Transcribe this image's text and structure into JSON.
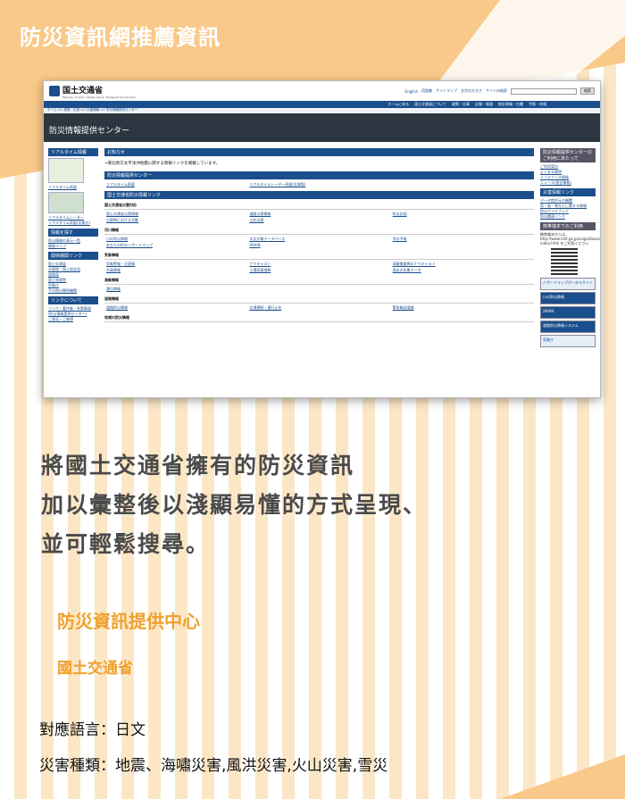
{
  "header": {
    "title": "防災資訊網推薦資訊"
  },
  "screenshot": {
    "logo_name": "国土交通省",
    "logo_en": "Ministry of Land, Infrastructure, Transport and Tourism",
    "util_links": [
      "English",
      "用語集",
      "サイトマップ",
      "文字の大きさ",
      "サイト内検索"
    ],
    "search_button": "検索",
    "nav_items": [
      "ホームに戻る",
      "国土交通省について",
      "政策・仕事",
      "広報・報道",
      "統計情報・白書",
      "手続・申請"
    ],
    "breadcrumb": "ホーム >> 政策・仕事 >> 災害情報 >> 防災情報提供センター",
    "banner_title": "防災情報提供センター",
    "left": {
      "realtime_header": "リアルタイム情報",
      "realtime_links": [
        "リアルタイム雨量",
        "リアルタイムレーダー",
        "リアルタイム雨量(気象庁)"
      ],
      "info_header": "情報を探す",
      "info_links": [
        "防災情報の表示一覧",
        "情報マップ"
      ],
      "related_header": "関係機関リンク",
      "related_links": [
        "国土交通省",
        "水管理・国土保全局",
        "道路局",
        "国土地理院",
        "気象庁",
        "その他の関係機関"
      ],
      "about_header": "リンクについて",
      "about_links": [
        "リンク・著作権・免責事項",
        "(防災情報提供センター)",
        "ご意見・ご感想"
      ]
    },
    "main": {
      "notice_header": "お知らせ",
      "notice_text": "→東北地方太平洋沖地震に関する情報リンクを掲載しています。",
      "center_header": "防災情報提供センター",
      "center_links": [
        "リアルタイム雨量",
        "リアルタイムレーダー雨量(広域版)"
      ],
      "mlit_header": "国土交通省防災情報リンク",
      "sections": [
        {
          "title": "国土交通省災害対応",
          "links": [
            "国土交通省災害情報",
            "道路災害情報",
            "防災計画",
            "災害時における活動",
            "土砂災害"
          ]
        },
        {
          "title": "河川情報",
          "links": [
            "川の防災情報",
            "水文水質データベース",
            "洪水予報",
            "あなたの町のハザードマップ",
            "XRAIN",
            ""
          ]
        },
        {
          "title": "気象情報",
          "links": [
            "気象警報・注意報",
            "ナウキャスト",
            "高解像度降水ナウキャスト",
            "台風情報",
            "土壌雨量指数",
            "過去の気象データ"
          ]
        },
        {
          "title": "海象情報",
          "links": [
            "潮位情報",
            "",
            ""
          ]
        },
        {
          "title": "道路情報",
          "links": [
            "道路防災情報",
            "交通規制・通行止め",
            "緊急輸送道路"
          ]
        },
        {
          "title": "地域の防災情報",
          "links": []
        }
      ]
    },
    "right": {
      "use_header": "防災情報提供センターのご利用にあたって",
      "use_links": [
        "ご利用案内",
        "よくある質問",
        "メンテナンス情報",
        "ニュース(過去情報)"
      ],
      "disaster_header": "災害情報リンク",
      "disaster_links": [
        "データ提供元の機関",
        "雨・風・雪などに関する情報",
        "防災ガイドブック",
        "防災関連リンク"
      ],
      "mobile_header": "携帯端末でのご利用",
      "mobile_text": "携帯端末からは、http://www.mlit.go.jp/saigai/bosaijoho/i-index.html をご利用ください",
      "banners": [
        "ハザードマップポータルサイト",
        "川の防災情報",
        "XRAIN",
        "道路防災情報システム",
        "気象庁"
      ]
    }
  },
  "description": [
    "將國土交通省擁有的防災資訊",
    "加以彙整後以淺顯易懂的方式呈現、",
    "並可輕鬆搜尋。"
  ],
  "organization": {
    "name": "防災資訊提供中心",
    "ministry": "國土交通省"
  },
  "meta": {
    "language": "對應語言：日文",
    "disasters": "災害種類：地震、海嘯災害,風洪災害,火山災害,雪災"
  },
  "colors": {
    "orange": "#f9c98a",
    "accent": "#f0a02c",
    "navy": "#1a4e8c"
  }
}
